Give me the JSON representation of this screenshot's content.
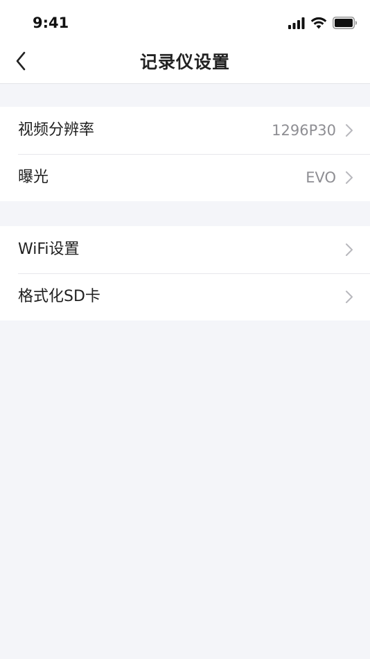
{
  "status_bar": {
    "time": "9:41",
    "icons": [
      "signal-icon",
      "wifi-icon",
      "battery-icon"
    ]
  },
  "nav": {
    "back_icon": "chevron-left-icon",
    "title": "记录仪设置"
  },
  "groups": [
    {
      "rows": [
        {
          "label": "视频分辨率",
          "value": "1296P30"
        },
        {
          "label": "曝光",
          "value": "EVO"
        }
      ]
    },
    {
      "rows": [
        {
          "label": "WiFi设置",
          "value": ""
        },
        {
          "label": "格式化SD卡",
          "value": ""
        }
      ]
    }
  ],
  "colors": {
    "background": "#f4f5f9",
    "card": "#ffffff",
    "text": "#1f1f1f",
    "secondary_text": "#8e8e93",
    "divider": "#e6e7eb"
  }
}
